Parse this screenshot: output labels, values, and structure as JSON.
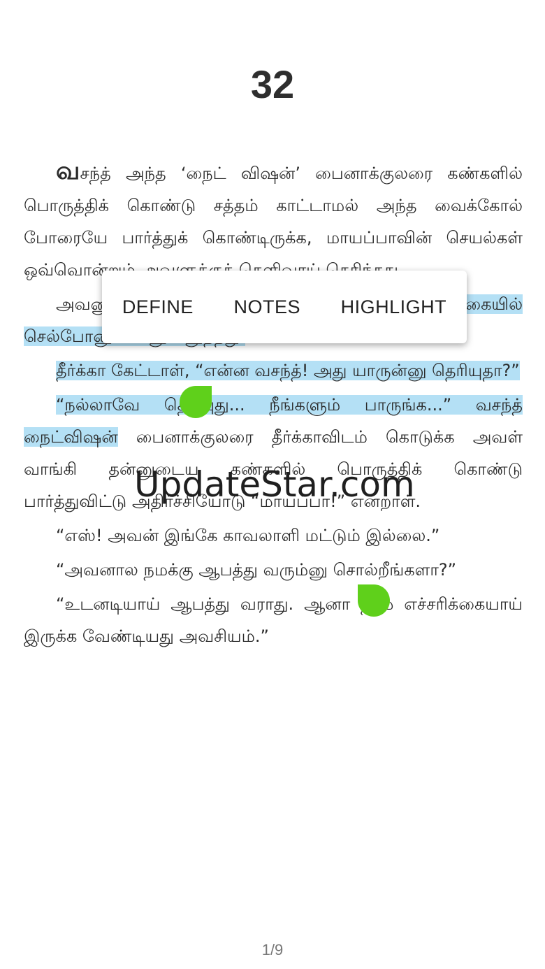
{
  "chapter_number": "32",
  "paragraphs": [
    {
      "dropcap": "வ",
      "text": "சந்த் அந்த ‘நைட் விஷன்’ பைனாக்குலரை கண்களில் பொருத்திக் கொண்டு சத்தம் காட்டாமல் அந்த வைக்கோல் போரையே பார்த்துக் கொண்டிருக்க, மாயப்பாவின் செயல்கள் ஒவ்வொன்றும் அவளுக்குத் தெளிவாய் தெரிந்தது."
    },
    {
      "before": "அவனுடைய ",
      "highlight": "ஒரு கையில் ரிவால்வரும், இன்னொரு கையில் செல்போனும் மினுமினுத்தது."
    },
    {
      "highlight": "தீர்க்கா கேட்டாள், “என்ன வசந்த்! அது யாருன்னு தெரியுதா?”"
    },
    {
      "highlight": "“நல்லாவே தெரியுது... நீங்களும் பாருங்க...” வசந்த் நைட்விஷன்",
      "after": " பைனாக்குலரை தீர்க்காவிடம் கொடுக்க அவள் வாங்கி தன்னுடைய கண்களில் பொருத்திக் கொண்டு பார்த்துவிட்டு அதிர்ச்சியோடு “மாயப்பா!” என்றாள்."
    },
    {
      "text": "“எஸ்! அவன் இங்கே காவலாளி மட்டும் இல்லை.”"
    },
    {
      "text": "“அவனால நமக்கு ஆபத்து வரும்னு சொல்றீங்களா?”"
    },
    {
      "text": "“உடனடியாய் ஆபத்து வராது. ஆனா நாம எச்சரிக்கையாய் இருக்க வேண்டியது அவசியம்.”"
    }
  ],
  "selection_menu": {
    "define_label": "DEFINE",
    "notes_label": "NOTES",
    "highlight_label": "HIGHLIGHT"
  },
  "watermark": "UpdateStar.com",
  "page_indicator": "1/9",
  "colors": {
    "highlight": "#b4e0f5",
    "selection_handle": "#5fd01b",
    "text": "#2b2b2b"
  }
}
